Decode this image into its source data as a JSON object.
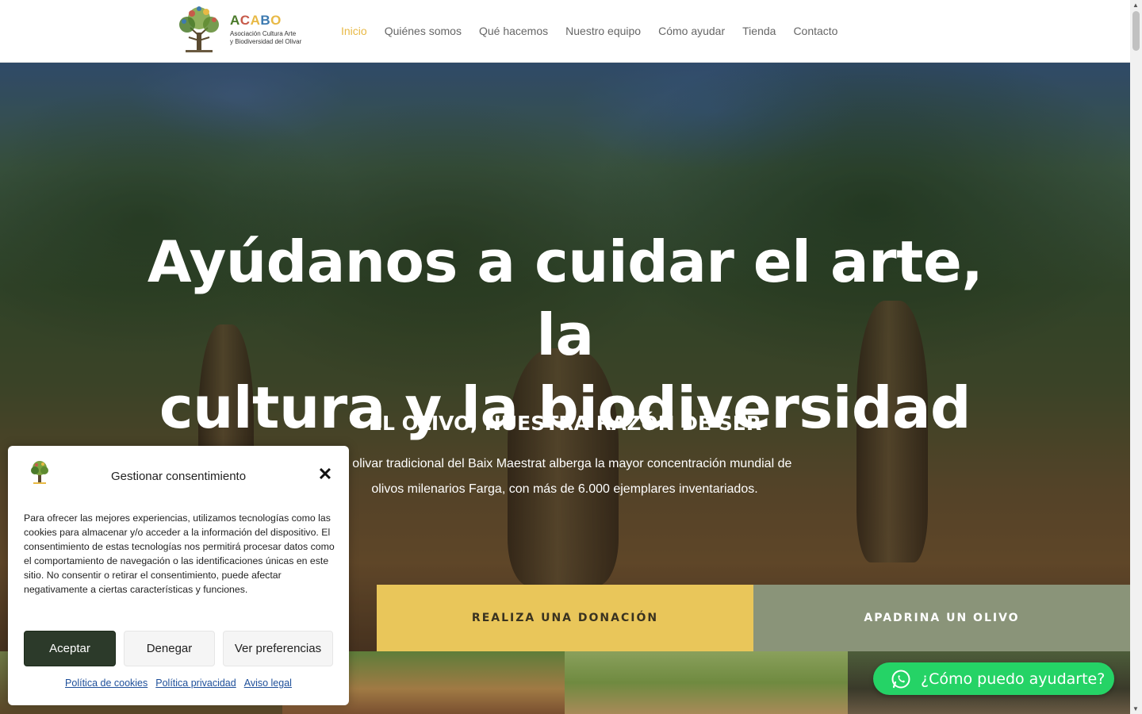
{
  "brand": {
    "name_parts": [
      "A",
      "C",
      "A",
      "B",
      "O"
    ],
    "subtitle_line1": "Asociación Cultura Arte",
    "subtitle_line2": "y Biodiversidad del Olivar"
  },
  "nav": {
    "items": [
      {
        "label": "Inicio",
        "active": true
      },
      {
        "label": "Quiénes somos"
      },
      {
        "label": "Qué hacemos"
      },
      {
        "label": "Nuestro equipo"
      },
      {
        "label": "Cómo ayudar"
      },
      {
        "label": "Tienda"
      },
      {
        "label": "Contacto"
      }
    ]
  },
  "hero": {
    "title_line1": "Ayúdanos a cuidar el arte, la",
    "title_line2": "cultura y la biodiversidad",
    "subtitle": "EL OLIVO, NUESTRA RAZÓN DE SER",
    "text_line1": "El olivar tradicional del Baix Maestrat  alberga la mayor concentración mundial de",
    "text_line2": "olivos milenarios Farga, con más de 6.000 ejemplares inventariados."
  },
  "cta": {
    "donate": "REALIZA UNA DONACIÓN",
    "adopt": "APADRINA UN OLIVO"
  },
  "whatsapp": {
    "label": "¿Cómo puedo ayudarte?",
    "icon": "whatsapp-icon"
  },
  "cookie": {
    "title": "Gestionar consentimiento",
    "body": "Para ofrecer las mejores experiencias, utilizamos tecnologías como las cookies para almacenar y/o acceder a la información del dispositivo. El consentimiento de estas tecnologías nos permitirá procesar datos como el comportamiento de navegación o las identificaciones únicas en este sitio. No consentir o retirar el consentimiento, puede afectar negativamente a ciertas características y funciones.",
    "accept": "Aceptar",
    "deny": "Denegar",
    "preferences": "Ver preferencias",
    "links": [
      "Política de cookies",
      "Política privacidad",
      "Aviso legal"
    ]
  },
  "colors": {
    "accent": "#e8b945",
    "donate_bg": "#e9c65a",
    "adopt_bg": "#8a9479",
    "whatsapp": "#25d366",
    "accept_bg": "#2c3a2a",
    "logo_letters": [
      "#4a7a2a",
      "#c75a4a",
      "#e8b945",
      "#3d7ab0",
      "#e8b945"
    ]
  }
}
